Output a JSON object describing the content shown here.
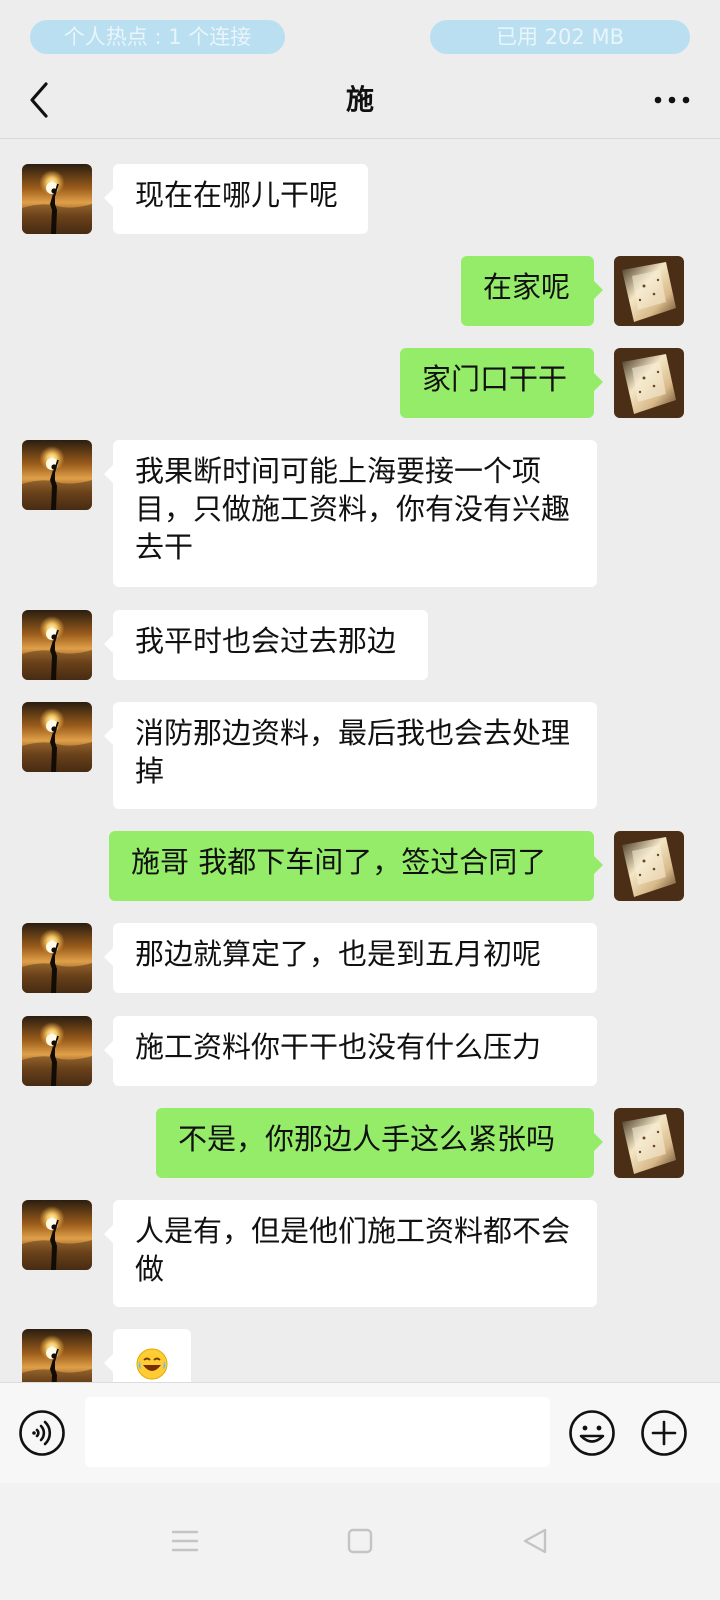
{
  "status_bar": {
    "hotspot": "个人热点 : 1 个连接",
    "usage": "已用 202 MB"
  },
  "header": {
    "title": "施",
    "back_icon": "chevron-left-icon",
    "more_icon": "more-horizontal-icon"
  },
  "messages": [
    {
      "side": "left",
      "text": "现在在哪儿干呢"
    },
    {
      "side": "right",
      "text": "在家呢"
    },
    {
      "side": "right",
      "text": "家门口干干"
    },
    {
      "side": "left",
      "text": "我果断时间可能上海要接一个项目，只做施工资料，你有没有兴趣去干"
    },
    {
      "side": "left",
      "text": "我平时也会过去那边"
    },
    {
      "side": "left",
      "text": "消防那边资料，最后我也会去处理掉"
    },
    {
      "side": "right",
      "text": "施哥 我都下车间了，签过合同了"
    },
    {
      "side": "left",
      "text": "那边就算定了，也是到五月初呢"
    },
    {
      "side": "left",
      "text": "施工资料你干干也没有什么压力"
    },
    {
      "side": "right",
      "text": "不是，你那边人手这么紧张吗"
    },
    {
      "side": "left",
      "text": "人是有，但是他们施工资料都不会做"
    },
    {
      "side": "left",
      "text": "",
      "emoji": "laughing-tears-emoji"
    }
  ],
  "input_bar": {
    "placeholder": "",
    "voice_icon": "voice-icon",
    "emoji_icon": "smiley-icon",
    "plus_icon": "plus-circle-icon"
  },
  "nav_bar": {
    "icons": [
      "menu-icon",
      "home-square-icon",
      "back-triangle-icon"
    ]
  },
  "colors": {
    "background": "#ededed",
    "sent_bubble": "#95ec69",
    "received_bubble": "#ffffff"
  }
}
